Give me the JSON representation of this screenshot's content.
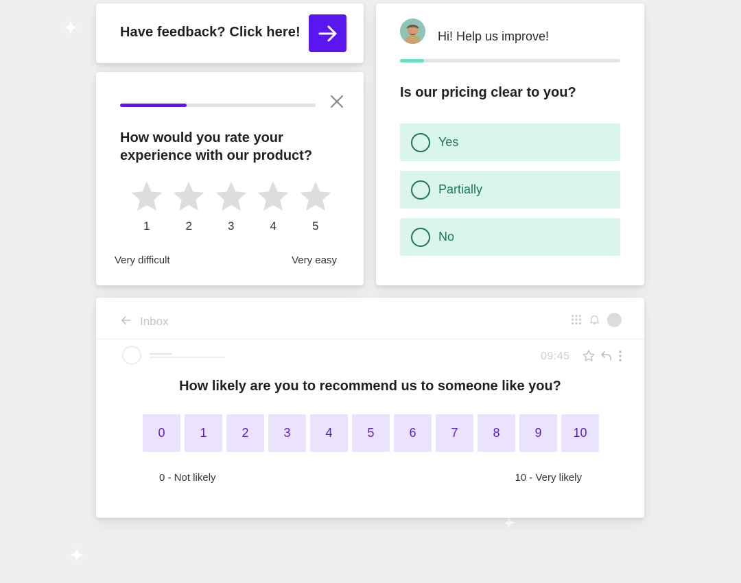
{
  "feedback_card": {
    "text": "Have feedback? Click here!",
    "button_icon": "arrow-right-icon",
    "accent": "#5a16f0"
  },
  "rating_card": {
    "progress": 0.34,
    "question": "How would you rate your experience with our product?",
    "stars": [
      "1",
      "2",
      "3",
      "4",
      "5"
    ],
    "low_label": "Very difficult",
    "high_label": "Very easy"
  },
  "pricing_card": {
    "greeting": "Hi! Help us improve!",
    "progress": 0.11,
    "question": "Is our pricing clear to you?",
    "options": [
      "Yes",
      "Partially",
      "No"
    ],
    "accent": "#1c7560"
  },
  "nps_card": {
    "header_title": "Inbox",
    "time": "09:45",
    "question": "How likely are you to recommend us to someone like you?",
    "scale": [
      "0",
      "1",
      "2",
      "3",
      "4",
      "5",
      "6",
      "7",
      "8",
      "9",
      "10"
    ],
    "low_label": "0 - Not likely",
    "high_label": "10 - Very likely"
  }
}
